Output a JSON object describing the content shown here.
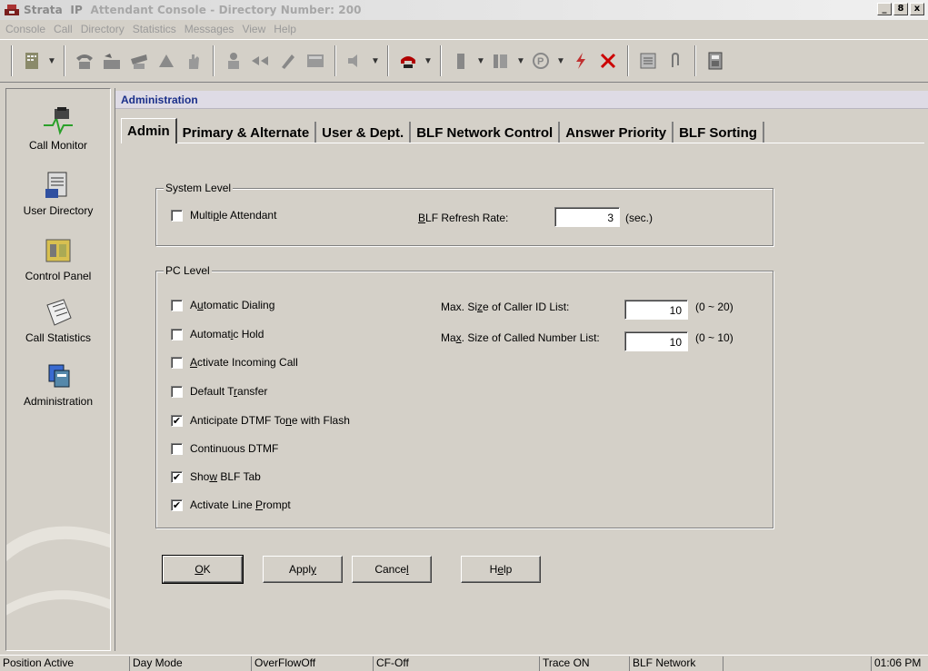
{
  "window": {
    "title_brand": "Strata",
    "title_ip": "IP",
    "title_rest": "Attendant Console - Directory Number: 200",
    "controls": [
      "_",
      "8",
      "x"
    ]
  },
  "menu": [
    "Console",
    "Call",
    "Directory",
    "Statistics",
    "Messages",
    "View",
    "Help"
  ],
  "nav": {
    "items": [
      {
        "label": "Call Monitor"
      },
      {
        "label": "User Directory"
      },
      {
        "label": "Control Panel"
      },
      {
        "label": "Call Statistics"
      },
      {
        "label": "Administration"
      }
    ]
  },
  "panel": {
    "header": "Administration",
    "tabs": [
      "Admin",
      "Primary & Alternate",
      "User & Dept.",
      "BLF Network Control",
      "Answer Priority",
      "BLF Sorting"
    ],
    "active_tab": "Admin"
  },
  "system_level": {
    "title": "System Level",
    "multiple_attendant": {
      "pre": "Multi",
      "ul": "p",
      "post": "le Attendant",
      "checked": false
    },
    "blf_refresh": {
      "pre": "",
      "ul": "B",
      "post": "LF Refresh Rate:",
      "value": "3",
      "unit": "(sec.)"
    }
  },
  "pc_level": {
    "title": "PC Level",
    "options": [
      {
        "pre": "A",
        "ul": "u",
        "post": "tomatic Dialing",
        "checked": false
      },
      {
        "pre": "Automat",
        "ul": "i",
        "post": "c Hold",
        "checked": false
      },
      {
        "pre": "",
        "ul": "A",
        "post": "ctivate Incoming Call",
        "checked": false
      },
      {
        "pre": "Default T",
        "ul": "r",
        "post": "ansfer",
        "checked": false
      },
      {
        "pre": "Anticipate DTMF To",
        "ul": "n",
        "post": "e with Flash",
        "checked": true
      },
      {
        "pre": "Continuous DTMF",
        "ul": "",
        "post": "",
        "checked": false
      },
      {
        "pre": "Sho",
        "ul": "w",
        "post": " BLF Tab",
        "checked": true
      },
      {
        "pre": "Activate Line ",
        "ul": "P",
        "post": "rompt",
        "checked": true
      }
    ],
    "caller_id": {
      "pre": "Max. Si",
      "ul": "z",
      "post": "e of Caller ID List:",
      "value": "10",
      "range": "(0 ~ 20)"
    },
    "called_number": {
      "pre": "Ma",
      "ul": "x",
      "post": ". Size of Called Number List:",
      "value": "10",
      "range": "(0 ~ 10)"
    }
  },
  "buttons": [
    {
      "pre": "",
      "ul": "O",
      "post": "K"
    },
    {
      "pre": "Appl",
      "ul": "y",
      "post": ""
    },
    {
      "pre": "Cance",
      "ul": "l",
      "post": ""
    },
    {
      "pre": "H",
      "ul": "e",
      "post": "lp"
    }
  ],
  "status": {
    "position": "Position Active",
    "mode": "Day Mode",
    "overflow": "OverFlowOff",
    "cf": "CF-Off",
    "trace": "Trace ON",
    "blf": "BLF Network",
    "time": "01:06 PM"
  }
}
